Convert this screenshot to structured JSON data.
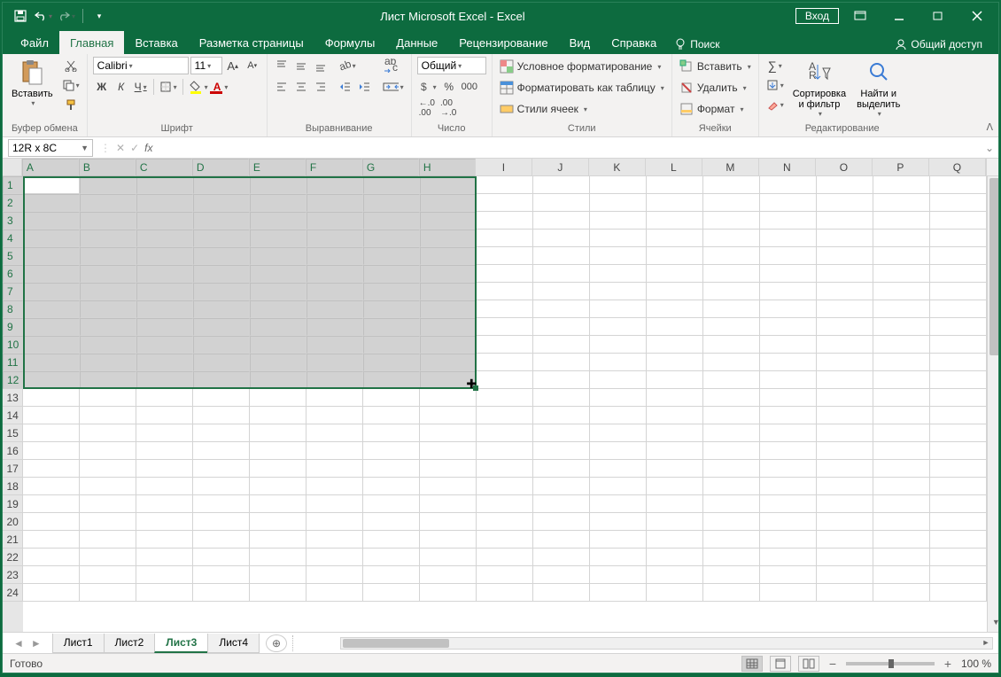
{
  "title": "Лист Microsoft Excel  -  Excel",
  "login_label": "Вход",
  "tabs": {
    "file": "Файл",
    "home": "Главная",
    "insert": "Вставка",
    "layout": "Разметка страницы",
    "formulas": "Формулы",
    "data": "Данные",
    "review": "Рецензирование",
    "view": "Вид",
    "help": "Справка",
    "tellme": "Поиск"
  },
  "share_label": "Общий доступ",
  "ribbon": {
    "clipboard": {
      "paste": "Вставить",
      "label": "Буфер обмена"
    },
    "font": {
      "name": "Calibri",
      "size": "11",
      "bold": "Ж",
      "italic": "К",
      "underline": "Ч",
      "label": "Шрифт"
    },
    "align": {
      "label": "Выравнивание"
    },
    "number": {
      "format": "Общий",
      "label": "Число"
    },
    "styles": {
      "cond": "Условное форматирование",
      "table": "Форматировать как таблицу",
      "cell": "Стили ячеек",
      "label": "Стили"
    },
    "cells": {
      "insert": "Вставить",
      "delete": "Удалить",
      "format": "Формат",
      "label": "Ячейки"
    },
    "editing": {
      "sort": "Сортировка\nи фильтр",
      "find": "Найти и\nвыделить",
      "label": "Редактирование"
    }
  },
  "formula_bar": {
    "namebox": "12R x 8C",
    "fx": "fx",
    "value": ""
  },
  "columns": [
    "A",
    "B",
    "C",
    "D",
    "E",
    "F",
    "G",
    "H",
    "I",
    "J",
    "K",
    "L",
    "M",
    "N",
    "O",
    "P",
    "Q"
  ],
  "rows": [
    "1",
    "2",
    "3",
    "4",
    "5",
    "6",
    "7",
    "8",
    "9",
    "10",
    "11",
    "12",
    "13",
    "14",
    "15",
    "16",
    "17",
    "18",
    "19",
    "20",
    "21",
    "22",
    "23",
    "24"
  ],
  "selection": {
    "cols": 8,
    "rows": 12,
    "active": "A1"
  },
  "sheets": {
    "items": [
      "Лист1",
      "Лист2",
      "Лист3",
      "Лист4"
    ],
    "active": 2
  },
  "status": {
    "ready": "Готово",
    "zoom": "100 %"
  },
  "colors": {
    "accent": "#217346",
    "titlebar": "#0d6b3f"
  }
}
